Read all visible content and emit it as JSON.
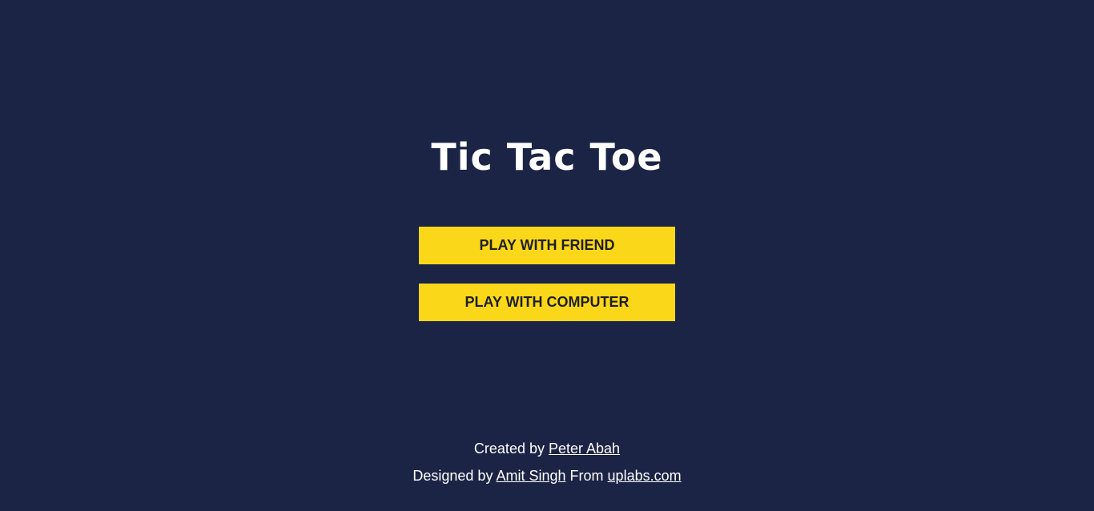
{
  "title": "Tic Tac Toe",
  "menu": {
    "play_friend_label": "PLAY WITH FRIEND",
    "play_computer_label": "PLAY WITH COMPUTER"
  },
  "footer": {
    "created_prefix": "Created by",
    "created_author": "Peter Abah",
    "designed_prefix": "Designed by",
    "designer": "Amit Singh",
    "from_text": "From",
    "source": "uplabs.com"
  },
  "colors": {
    "background": "#1b2445",
    "button": "#fbd71a",
    "button_text": "#1f1f1f",
    "text": "#ffffff"
  }
}
